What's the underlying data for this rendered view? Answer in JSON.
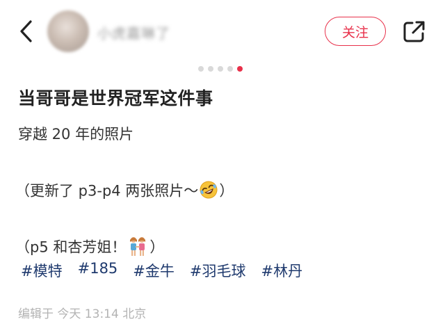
{
  "header": {
    "username": "小虎嘉琳了",
    "follow_label": "关注"
  },
  "carousel": {
    "total": 5,
    "active_index": 4
  },
  "post": {
    "title": "当哥哥是世界冠军这件事",
    "line1": "穿越 20 年的照片",
    "line2": "（更新了 p3-p4 两张照片～",
    "line2_end": "）",
    "line3": "（p5 和杏芳姐！",
    "line3_end": "）",
    "tags": [
      "#模特",
      "#185",
      "#金牛",
      "#羽毛球",
      "#林丹"
    ],
    "meta": "编辑于  今天 13:14 北京"
  },
  "icons": {
    "back": "chevron-left-icon",
    "share": "share-icon",
    "emoji1": "rolling-laughing-emoji",
    "emoji2": "two-women-holding-hands-emoji"
  },
  "colors": {
    "accent": "#e8304a",
    "tag": "#1f3a6e",
    "meta": "#b3b3b3"
  }
}
